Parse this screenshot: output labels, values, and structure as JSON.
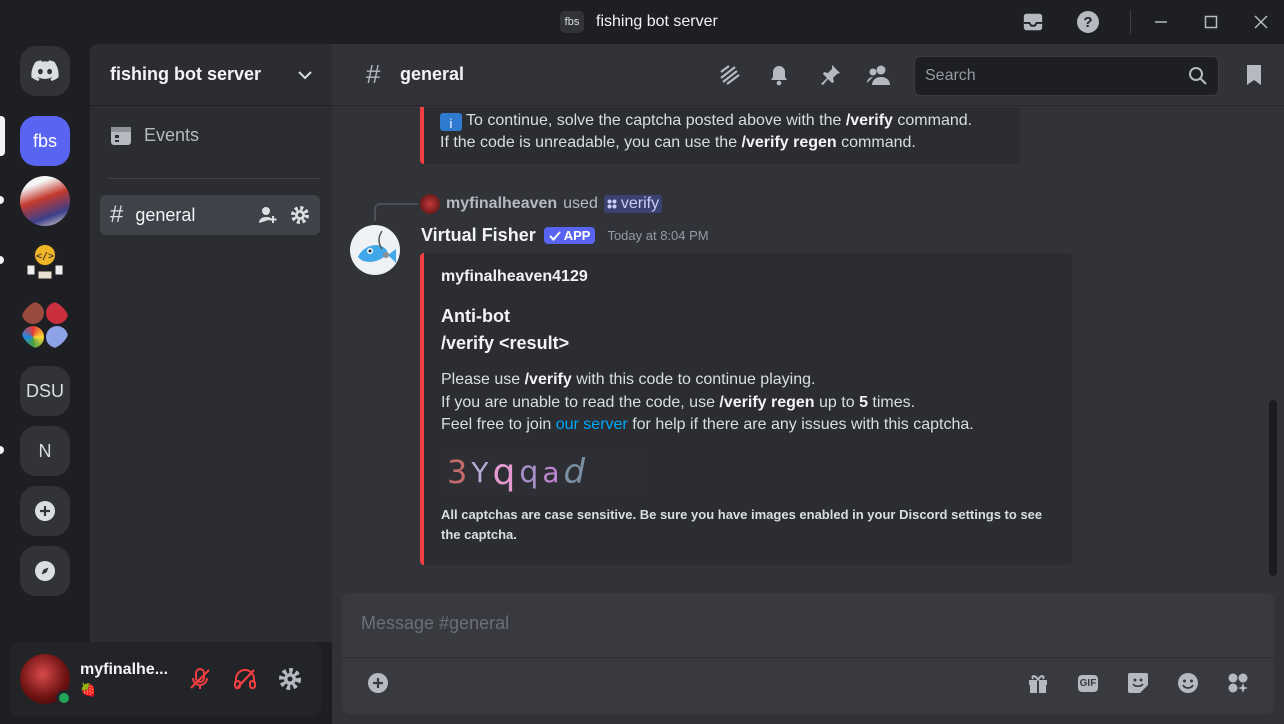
{
  "window": {
    "badge": "fbs",
    "title": "fishing bot server"
  },
  "servers": [
    {
      "label": "fbs"
    },
    {
      "label": "DSU"
    },
    {
      "label": "N"
    }
  ],
  "sidebar": {
    "server_name": "fishing bot server",
    "events_label": "Events",
    "channel_name": "general"
  },
  "user": {
    "name": "myfinalhe...",
    "status_emoji": "🍓"
  },
  "header": {
    "channel": "general",
    "search_placeholder": "Search"
  },
  "messages": {
    "prev_embed": {
      "line1_pre": "To continue, solve the captcha posted above with the ",
      "line1_cmd": "/verify",
      "line1_post": " command.",
      "line2_pre": "If the code is unreadable, you can use the ",
      "line2_cmd": "/verify regen",
      "line2_post": " command."
    },
    "reply": {
      "user": "myfinalheaven",
      "used": "used",
      "command": "verify"
    },
    "bot": {
      "name": "Virtual Fisher",
      "tag": "APP",
      "time": "Today at 8:04 PM"
    },
    "embed": {
      "author": "myfinalheaven4129",
      "title1": "Anti-bot",
      "title2": "/verify <result>",
      "l1_pre": "Please use ",
      "l1_cmd": "/verify",
      "l1_post": " with this code to continue playing.",
      "l2_pre": "If you are unable to read the code, use ",
      "l2_cmd": "/verify regen",
      "l2_mid": " up to ",
      "l2_num": "5",
      "l2_post": " times.",
      "l3_pre": "Feel free to join ",
      "l3_link": "our server",
      "l3_post": " for help if there are any issues with this captcha.",
      "captcha_chars": [
        "3",
        "Y",
        "q",
        "q",
        "a",
        "d"
      ],
      "footer": "All captchas are case sensitive. Be sure you have images enabled in your Discord settings to see the captcha."
    }
  },
  "composer": {
    "placeholder": "Message #general",
    "gif_label": "GIF"
  },
  "colors": {
    "accent": "#5865f2",
    "embed_border": "#f23f42",
    "online": "#23a55a",
    "link": "#00a8fc"
  }
}
